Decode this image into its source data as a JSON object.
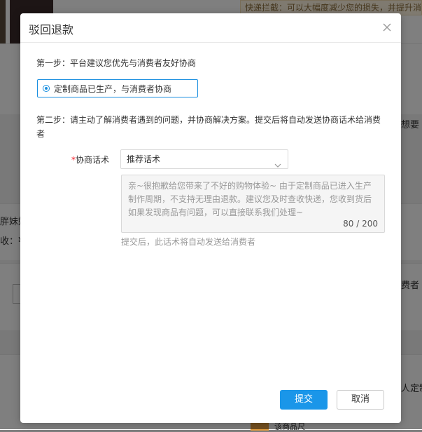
{
  "background": {
    "notice_text": "快递拦截：可以大幅度减少您的损失，并提升消",
    "text_fragments": [
      "想要",
      "胖妹妹",
      "收：¥",
      "费者",
      "人定制",
      "该商品尺"
    ]
  },
  "dialog": {
    "title": "驳回退款",
    "step1": {
      "text": "第一步：平台建议您优先与消费者友好协商",
      "option_label": "定制商品已生产，与消费者协商"
    },
    "step2": {
      "text": "第二步：请主动了解消费者遇到的问题，并协商解决方案。提交后将自动发送协商话术给消费者"
    },
    "field": {
      "required_mark": "*",
      "label": "协商话术",
      "select_value": "推荐话术",
      "message": "亲~很抱歉给您带来了不好的购物体验~ 由于定制商品已进入生产制作周期，不支持无理由退款。建议您及时查收快递，您收到货后如果发现商品有问题，可以直接联系我们处理~",
      "count": "80",
      "count_sep": " / ",
      "max": "200",
      "hint": "提交后，此话术将自动发送给消费者"
    },
    "buttons": {
      "submit": "提交",
      "cancel": "取消"
    }
  }
}
